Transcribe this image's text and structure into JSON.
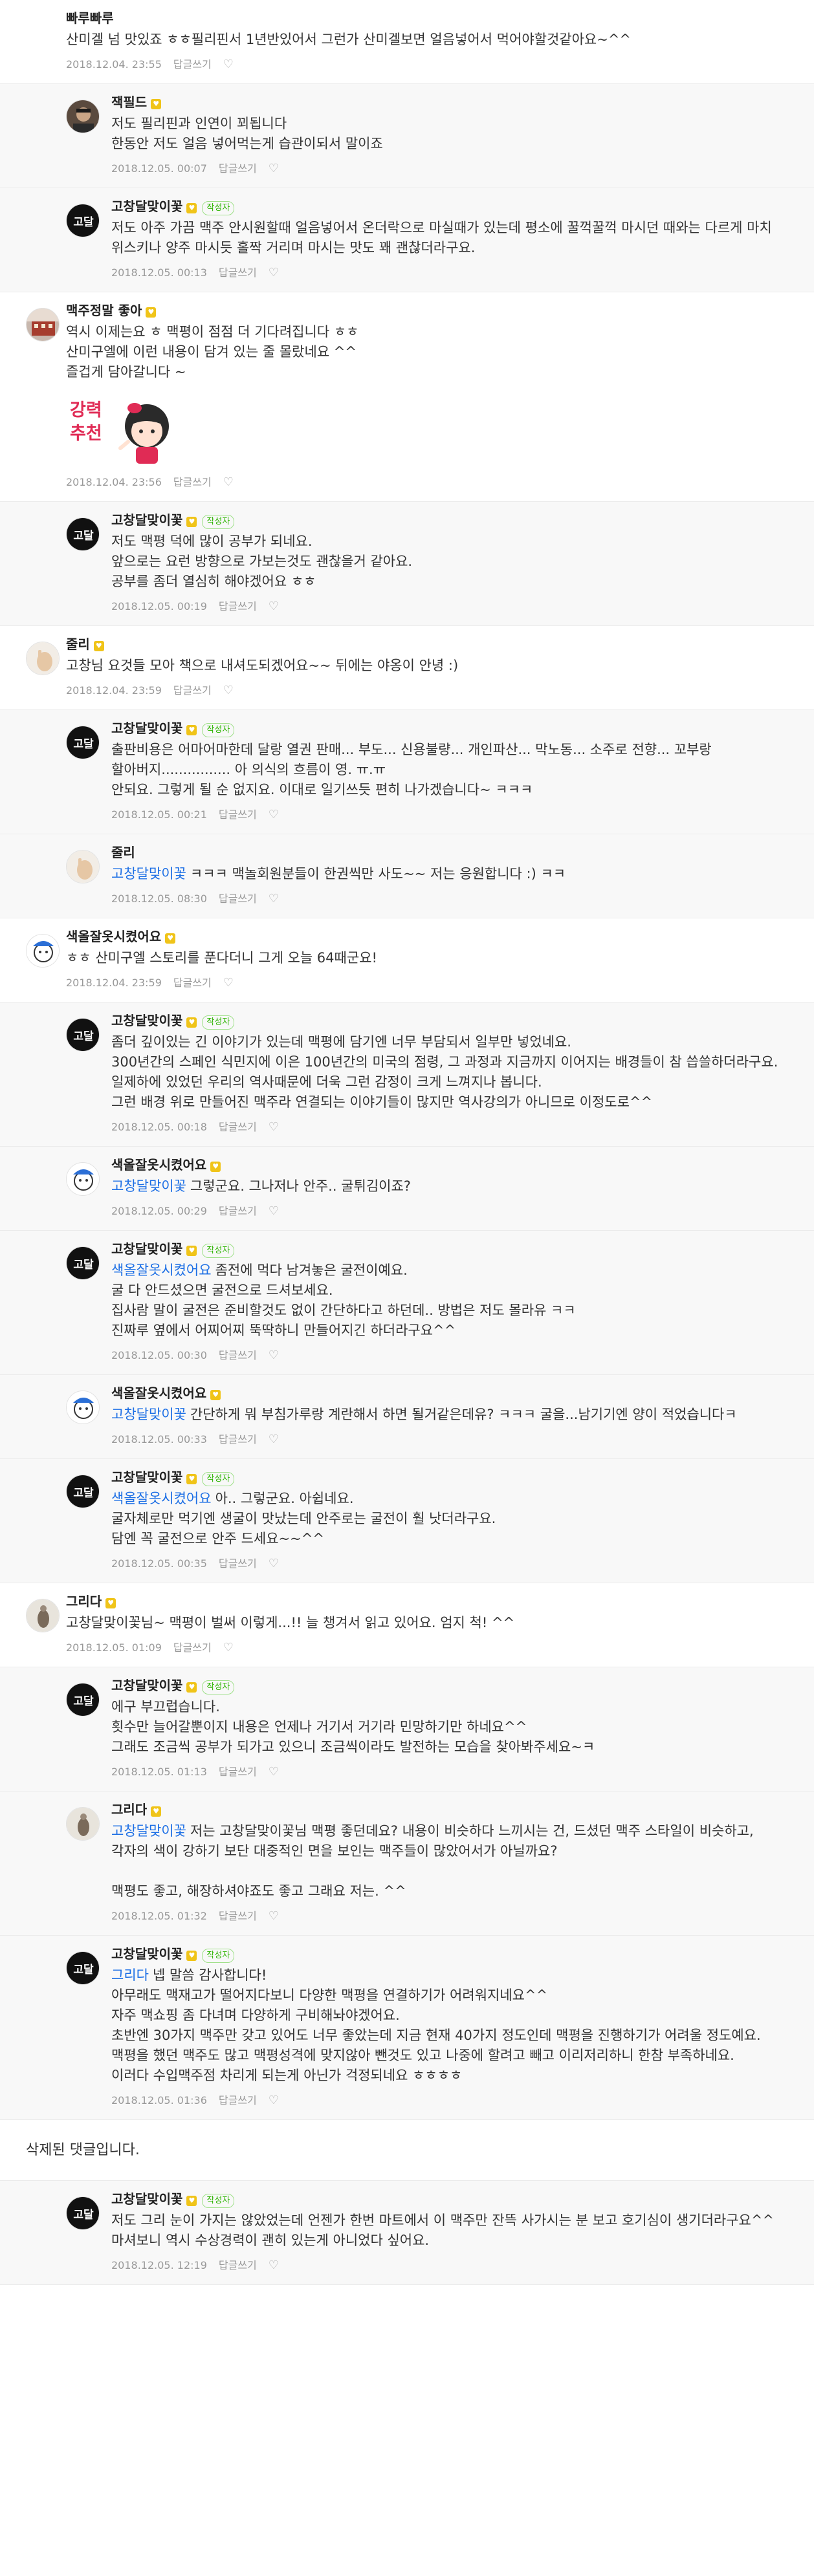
{
  "deleted_label": "삭제된 댓글입니다.",
  "author_badge": "작성자",
  "reply_label": "답글쓰기",
  "comments": [
    {
      "type": "top",
      "name": "빠루빠루",
      "badge": false,
      "author": false,
      "avatar": "none",
      "mention": "",
      "text": "산미겔 넘 맛있죠 ㅎㅎ필리핀서 1년반있어서 그런가 산미겔보면 얼음넣어서 먹어야할것같아요~^^",
      "date": "2018.12.04. 23:55",
      "sticker": false
    },
    {
      "type": "reply",
      "name": "잭필드",
      "badge": true,
      "author": false,
      "avatar": "man",
      "mention": "",
      "text": "저도 필리핀과 인연이 꾀됩니다\n한동안 저도 얼음 넣어먹는게 습관이되서 말이죠",
      "date": "2018.12.05. 00:07",
      "sticker": false
    },
    {
      "type": "reply",
      "name": "고창달맞이꽃",
      "badge": true,
      "author": true,
      "avatar": "logo",
      "mention": "",
      "text": "저도 아주 가끔 맥주 안시원할때 얼음넣어서 온더락으로 마실때가 있는데 평소에 꿀꺽꿀꺽 마시던 때와는 다르게 마치 위스키나 양주 마시듯 홀짝 거리며 마시는 맛도 꽤 괜찮더라구요.",
      "date": "2018.12.05. 00:13",
      "sticker": false
    },
    {
      "type": "top",
      "name": "맥주정말 좋아",
      "badge": true,
      "author": false,
      "avatar": "building",
      "mention": "",
      "text": "역시 이제는요 ㅎ 맥평이 점점 더 기다려집니다 ㅎㅎ\n산미구엘에 이런 내용이 담겨 있는 줄 몰랐네요 ^^\n즐겁게 담아갈니다 ~",
      "date": "2018.12.04. 23:56",
      "sticker": true,
      "sticker_text": "강력\n추천"
    },
    {
      "type": "reply",
      "name": "고창달맞이꽃",
      "badge": true,
      "author": true,
      "avatar": "logo",
      "mention": "",
      "text": "저도 맥평 덕에 많이 공부가 되네요.\n앞으로는 요런 방향으로 가보는것도 괜찮을거 같아요.\n공부를 좀더 열심히 해야겠어요 ㅎㅎ",
      "date": "2018.12.05. 00:19",
      "sticker": false
    },
    {
      "type": "top",
      "name": "줄리",
      "badge": true,
      "author": false,
      "avatar": "hand",
      "mention": "",
      "text": "고창님 요것들 모아 책으로 내셔도되겠어요~~ 뒤에는 야옹이 안녕 :)",
      "date": "2018.12.04. 23:59",
      "sticker": false
    },
    {
      "type": "reply",
      "name": "고창달맞이꽃",
      "badge": true,
      "author": true,
      "avatar": "logo",
      "mention": "",
      "text": "출판비용은 어마어마한데 달랑 열권 판매... 부도... 신용불량... 개인파산... 막노동... 소주로 전향... 꼬부랑 할아버지................ 아 의식의 흐름이 영. ㅠ.ㅠ\n안되요. 그렇게 될 순 없지요. 이대로 일기쓰듯 편히 나가겠습니다~ ㅋㅋㅋ",
      "date": "2018.12.05. 00:21",
      "sticker": false
    },
    {
      "type": "reply",
      "name": "줄리",
      "badge": false,
      "author": false,
      "avatar": "hand",
      "mention": "고창달맞이꽃",
      "text": "ㅋㅋㅋ 맥놀회원분들이 한권씩만 사도~~ 저는 응원합니다 :) ㅋㅋ",
      "date": "2018.12.05. 08:30",
      "sticker": false
    },
    {
      "type": "top",
      "name": "색올잘옷시켰어요",
      "badge": true,
      "author": false,
      "avatar": "cartoon",
      "mention": "",
      "text": "ㅎㅎ 산미구엘 스토리를 푼다더니 그게 오늘 64때군요!",
      "date": "2018.12.04. 23:59",
      "sticker": false
    },
    {
      "type": "reply",
      "name": "고창달맞이꽃",
      "badge": true,
      "author": true,
      "avatar": "logo",
      "mention": "",
      "text": "좀더 깊이있는 긴 이야기가 있는데 맥평에 담기엔 너무 부담되서 일부만 넣었네요.\n300년간의 스페인 식민지에 이은 100년간의 미국의 점령, 그 과정과 지금까지 이어지는 배경들이 참 씁쓸하더라구요. 일제하에 있었던 우리의 역사때문에 더욱 그런 감정이 크게 느껴지나 봅니다.\n그런 배경 위로 만들어진 맥주라 연결되는 이야기들이 많지만 역사강의가 아니므로 이정도로^^",
      "date": "2018.12.05. 00:18",
      "sticker": false
    },
    {
      "type": "reply",
      "name": "색올잘옷시켰어요",
      "badge": true,
      "author": false,
      "avatar": "cartoon",
      "mention": "고창달맞이꽃",
      "text": "그렇군요. 그나저나 안주.. 굴튀김이죠?",
      "date": "2018.12.05. 00:29",
      "sticker": false
    },
    {
      "type": "reply",
      "name": "고창달맞이꽃",
      "badge": true,
      "author": true,
      "avatar": "logo",
      "mention": "색올잘옷시켰어요",
      "text": "좀전에 먹다 남겨놓은 굴전이예요.\n굴 다 안드셨으면 굴전으로 드셔보세요.\n집사람 말이 굴전은 준비할것도 없이 간단하다고 하던데.. 방법은 저도 몰라유 ㅋㅋ\n진짜루 옆에서 어찌어찌 뚝딱하니 만들어지긴 하더라구요^^",
      "date": "2018.12.05. 00:30",
      "sticker": false
    },
    {
      "type": "reply",
      "name": "색올잘옷시켰어요",
      "badge": true,
      "author": false,
      "avatar": "cartoon",
      "mention": "고창달맞이꽃",
      "text": "간단하게 뭐 부침가루랑 계란해서 하면 될거같은데유? ㅋㅋㅋ 굴을...남기기엔 양이 적었습니다ㅋ",
      "date": "2018.12.05. 00:33",
      "sticker": false
    },
    {
      "type": "reply",
      "name": "고창달맞이꽃",
      "badge": true,
      "author": true,
      "avatar": "logo",
      "mention": "색올잘옷시켰어요",
      "text": "아.. 그렇군요. 아쉽네요.\n굴자체로만 먹기엔 생굴이 맛났는데 안주로는 굴전이 훨 낫더라구요.\n담엔 꼭 굴전으로 안주 드세요~~^^",
      "date": "2018.12.05. 00:35",
      "sticker": false
    },
    {
      "type": "top",
      "name": "그리다",
      "badge": true,
      "author": false,
      "avatar": "stone",
      "mention": "",
      "text": "고창달맞이꽃님~ 맥평이 벌써 이렇게...!! 늘 챙겨서 읽고 있어요. 엄지 척! ^^",
      "date": "2018.12.05. 01:09",
      "sticker": false
    },
    {
      "type": "reply",
      "name": "고창달맞이꽃",
      "badge": true,
      "author": true,
      "avatar": "logo",
      "mention": "",
      "text": "에구 부끄럽습니다.\n횟수만 늘어갈뿐이지 내용은 언제나 거기서 거기라 민망하기만 하네요^^\n그래도 조금씩 공부가 되가고 있으니 조금씩이라도 발전하는 모습을 찾아봐주세요~ㅋ",
      "date": "2018.12.05. 01:13",
      "sticker": false
    },
    {
      "type": "reply",
      "name": "그리다",
      "badge": true,
      "author": false,
      "avatar": "stone",
      "mention": "고창달맞이꽃",
      "text": "저는 고창달맞이꽃님 맥평 좋던데요? 내용이 비슷하다 느끼시는 건, 드셨던 맥주 스타일이 비슷하고, 각자의 색이 강하기 보단 대중적인 면을 보인는 맥주들이 많았어서가 아닐까요?\n\n맥평도 좋고, 해장하셔야죠도 좋고 그래요 저는. ^^",
      "date": "2018.12.05. 01:32",
      "sticker": false
    },
    {
      "type": "reply",
      "name": "고창달맞이꽃",
      "badge": true,
      "author": true,
      "avatar": "logo",
      "mention": "그리다",
      "text": "넵 말씀 감사합니다!\n아무래도 맥재고가 떨어지다보니 다양한 맥평을 연결하기가 어려워지네요^^\n자주 맥쇼핑 좀 다녀며 다양하게 구비해놔야겠어요.\n초반엔 30가지 맥주만 갖고 있어도 너무 좋았는데 지금 현재 40가지 정도인데 맥평을 진행하기가 어려울 정도예요.\n맥평을 했던 맥주도 많고 맥평성격에 맞지않아 뺀것도 있고 나중에 할려고 빼고 이리저리하니 한참 부족하네요.\n이러다 수입맥주점 차리게 되는게 아닌가 걱정되네요 ㅎㅎㅎㅎ",
      "date": "2018.12.05. 01:36",
      "sticker": false
    },
    {
      "type": "deleted"
    },
    {
      "type": "reply",
      "name": "고창달맞이꽃",
      "badge": true,
      "author": true,
      "avatar": "logo",
      "mention": "",
      "text": "저도 그리 눈이 가지는 않았었는데 언젠가 한번 마트에서 이 맥주만 잔뜩 사가시는 분 보고 호기심이 생기더라구요^^\n마셔보니 역시 수상경력이 괜히 있는게 아니었다 싶어요.",
      "date": "2018.12.05. 12:19",
      "sticker": false
    }
  ]
}
